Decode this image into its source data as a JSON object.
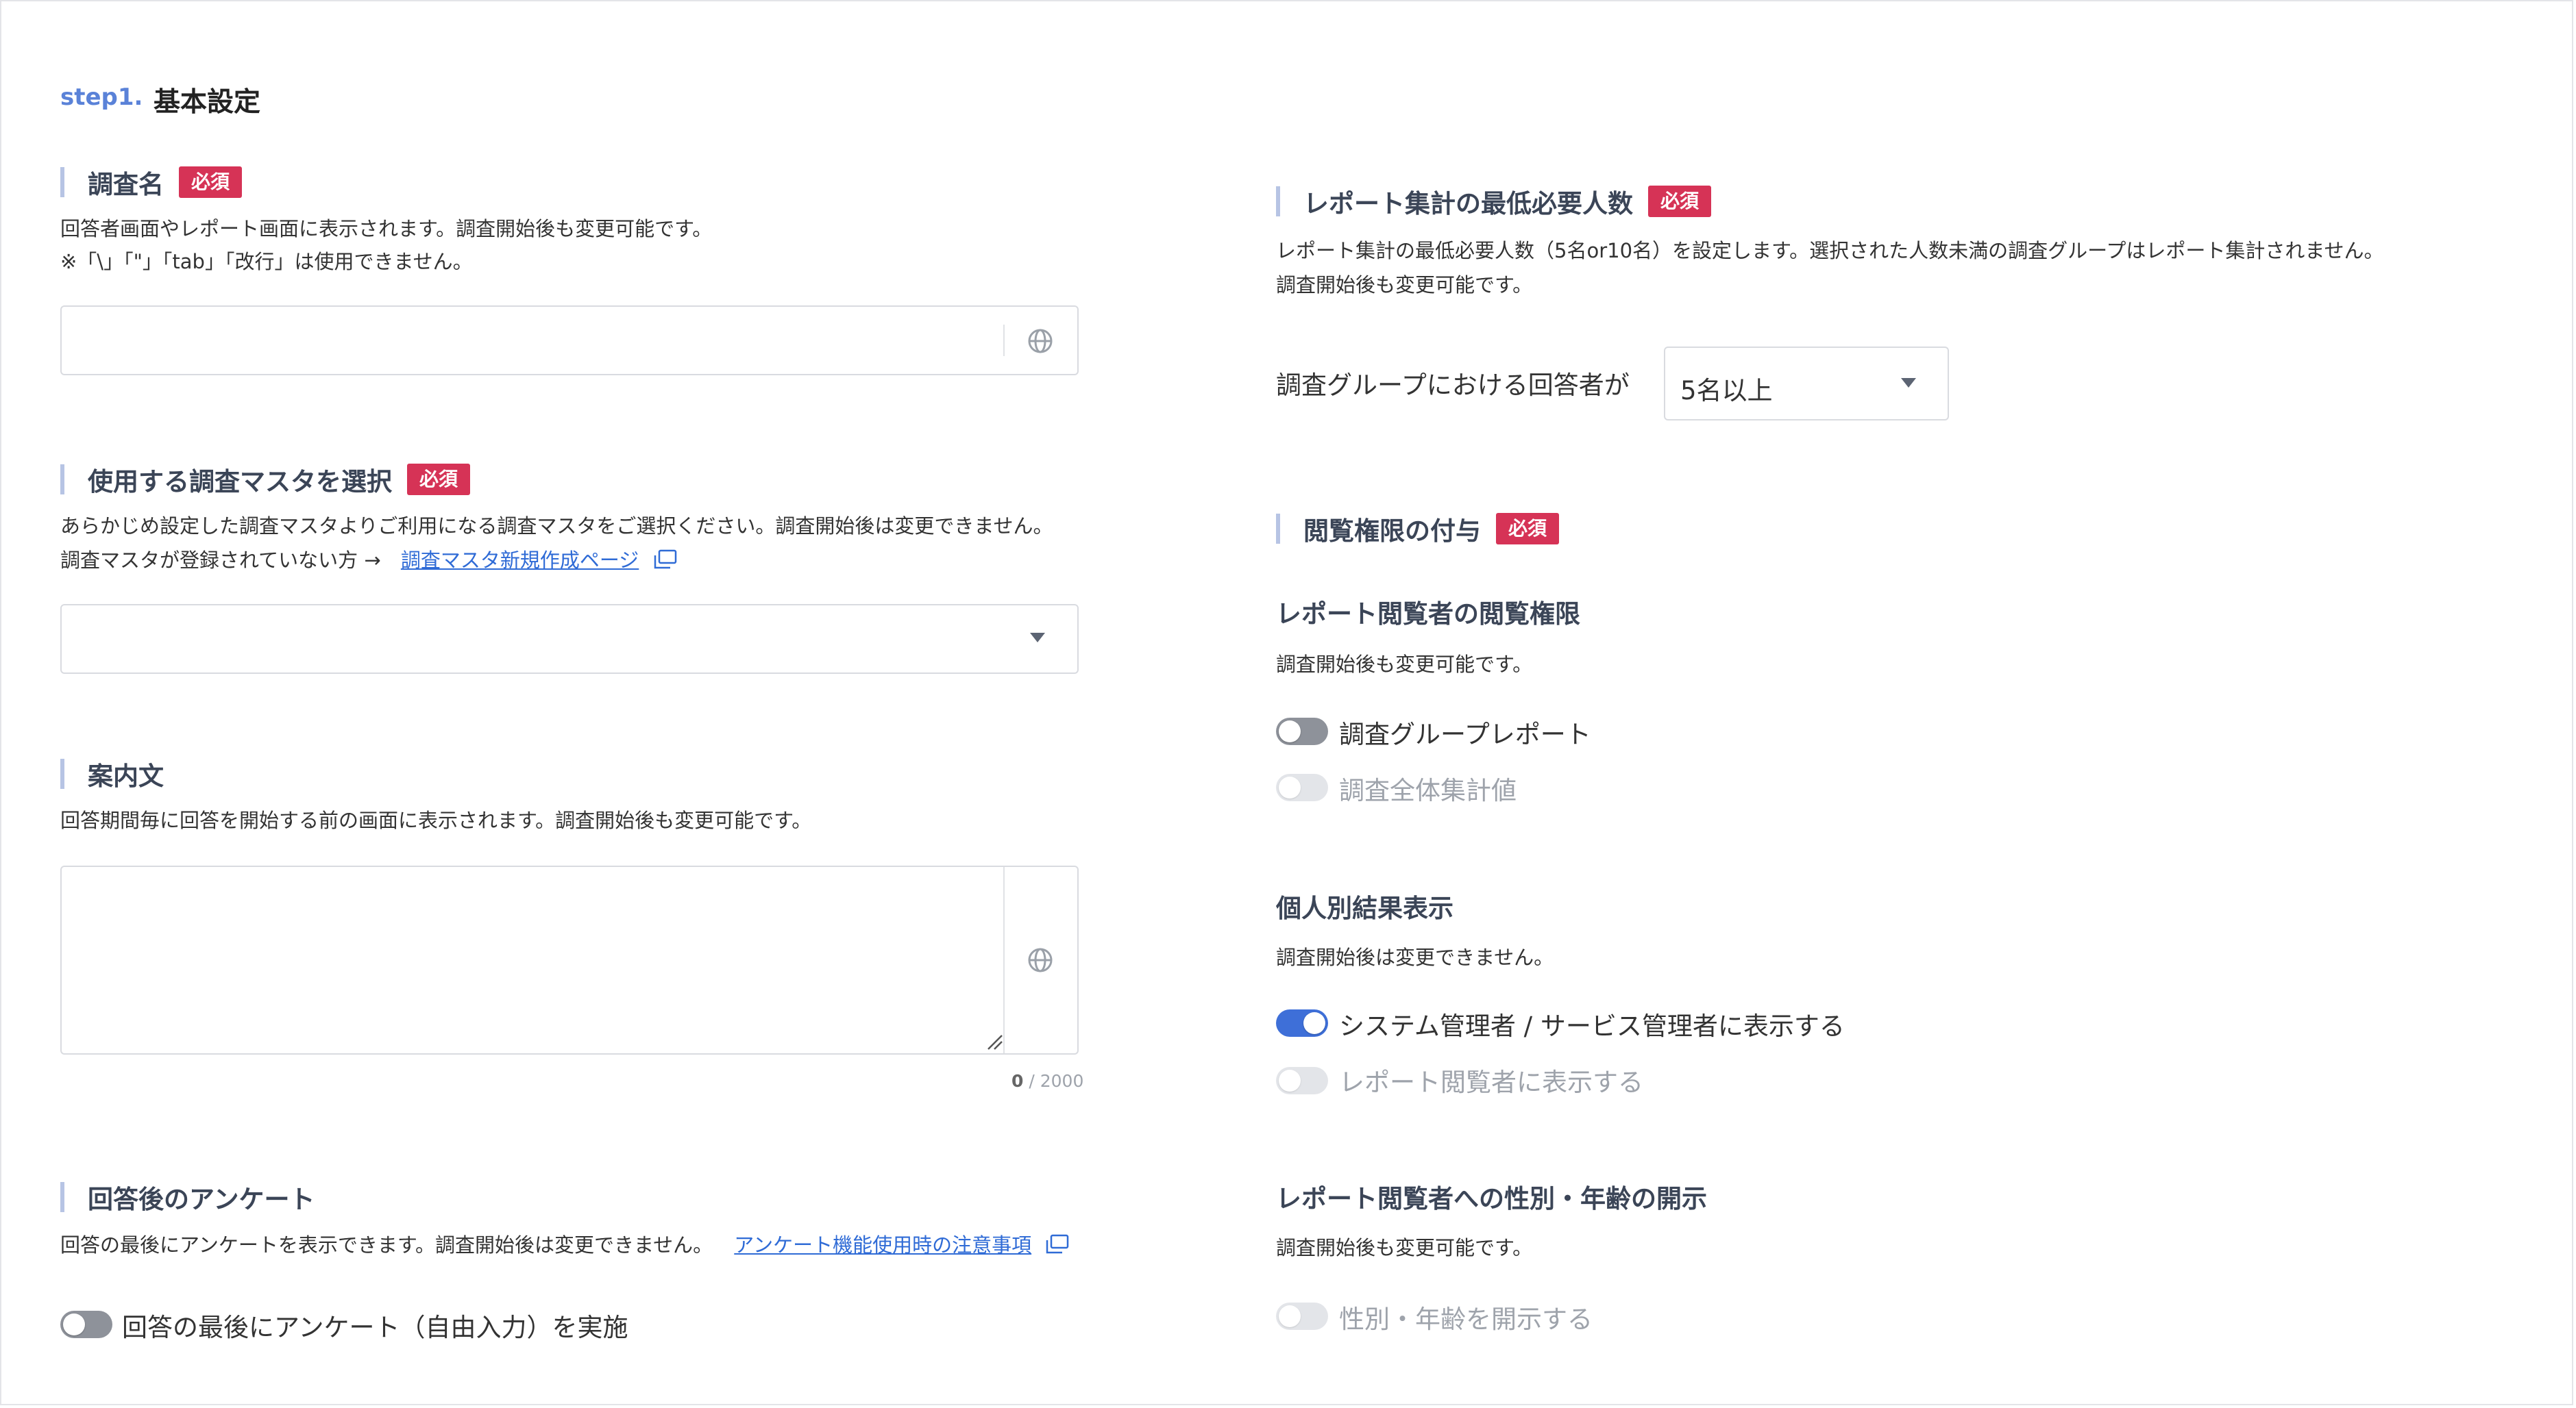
{
  "step": {
    "label": "step1.",
    "title": "基本設定"
  },
  "required_badge": "必須",
  "survey_name": {
    "heading": "調査名",
    "desc1": "回答者画面やレポート画面に表示されます。調査開始後も変更可能です。",
    "desc2": "※「\\」「\"」「tab」「改行」は使用できません。",
    "value": "",
    "placeholder": ""
  },
  "master": {
    "heading": "使用する調査マスタを選択",
    "desc1": "あらかじめ設定した調査マスタよりご利用になる調査マスタをご選択ください。調査開始後は変更できません。",
    "desc2_prefix": "調査マスタが登録されていない方 →",
    "link": "調査マスタ新規作成ページ",
    "selected": ""
  },
  "guide": {
    "heading": "案内文",
    "desc": "回答期間毎に回答を開始する前の画面に表示されます。調査開始後も変更可能です。",
    "value": "",
    "count": "0",
    "max": "/ 2000"
  },
  "post_survey": {
    "heading": "回答後のアンケート",
    "desc": "回答の最後にアンケートを表示できます。調査開始後は変更できません。",
    "link": "アンケート機能使用時の注意事項",
    "toggle_label": "回答の最後にアンケート（自由入力）を実施",
    "toggle_on": false
  },
  "min_respondents": {
    "heading": "レポート集計の最低必要人数",
    "desc1": "レポート集計の最低必要人数（5名or10名）を設定します。選択された人数未満の調査グループはレポート集計されません。",
    "desc2": "調査開始後も変更可能です。",
    "select_label": "調査グループにおける回答者が",
    "selected": "5名以上"
  },
  "permissions": {
    "heading": "閲覧権限の付与",
    "viewer": {
      "heading": "レポート閲覧者の閲覧権限",
      "desc": "調査開始後も変更可能です。",
      "toggles": [
        {
          "label": "調査グループレポート",
          "state": "off"
        },
        {
          "label": "調査全体集計値",
          "state": "disabled"
        }
      ]
    },
    "individual": {
      "heading": "個人別結果表示",
      "desc": "調査開始後は変更できません。",
      "toggles": [
        {
          "label": "システム管理者 / サービス管理者に表示する",
          "state": "on"
        },
        {
          "label": "レポート閲覧者に表示する",
          "state": "disabled"
        }
      ]
    },
    "gender_age": {
      "heading": "レポート閲覧者への性別・年齢の開示",
      "desc": "調査開始後も変更可能です。",
      "toggles": [
        {
          "label": "性別・年齢を開示する",
          "state": "disabled"
        }
      ]
    }
  },
  "colors": {
    "accent": "#3e6fd8",
    "badge": "#d63356",
    "section_bar": "#b7c4e4",
    "link": "#2f6bd6"
  }
}
